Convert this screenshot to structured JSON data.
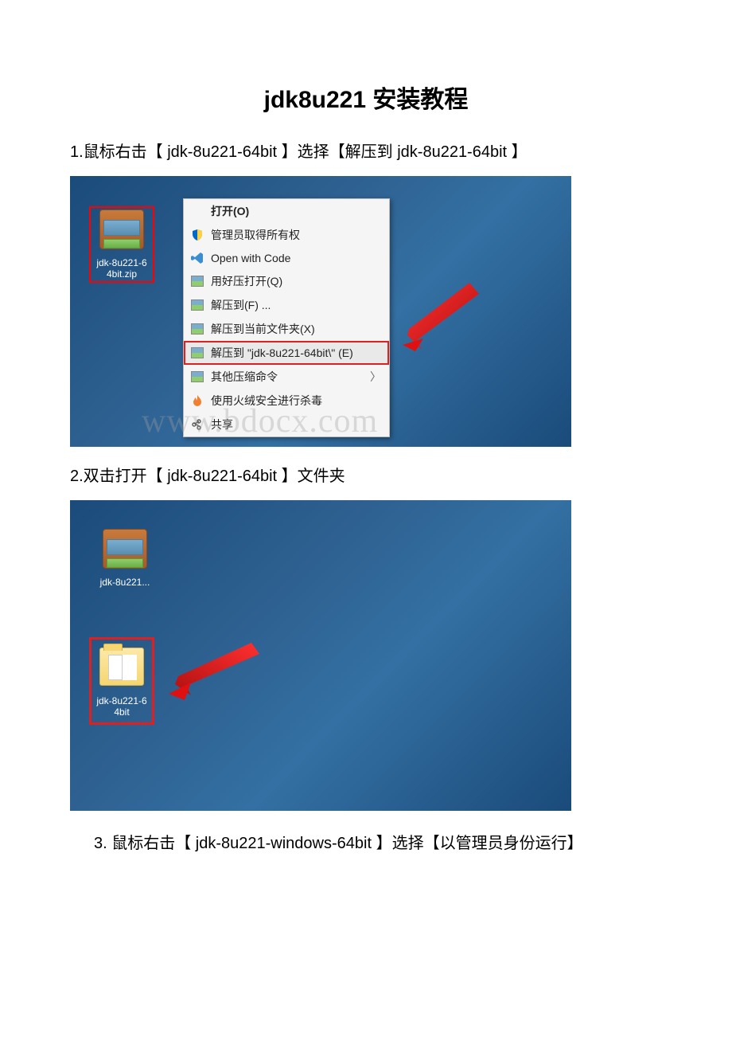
{
  "title": "jdk8u221 安装教程",
  "steps": {
    "s1": "1.鼠标右击【 jdk-8u221-64bit 】选择【解压到 jdk-8u221-64bit 】",
    "s2": "2.双击打开【 jdk-8u221-64bit 】文件夹",
    "s3": "3. 鼠标右击【 jdk-8u221-windows-64bit 】选择【以管理员身份运行】"
  },
  "shot1": {
    "zip_label_line1": "jdk-8u221-6",
    "zip_label_line2": "4bit.zip",
    "menu": {
      "open": "打开(O)",
      "admin": "管理员取得所有权",
      "vscode": "Open with Code",
      "haozip_open": "用好压打开(Q)",
      "extract_to": "解压到(F) ...",
      "extract_here": "解压到当前文件夹(X)",
      "extract_named": "解压到 \"jdk-8u221-64bit\\\" (E)",
      "other_compress": "其他压缩命令",
      "virus_scan": "使用火绒安全进行杀毒",
      "share": "共享"
    }
  },
  "shot2": {
    "zip_label": "jdk-8u221...",
    "folder_label_line1": "jdk-8u221-6",
    "folder_label_line2": "4bit"
  },
  "watermark": "www.bdocx.com"
}
